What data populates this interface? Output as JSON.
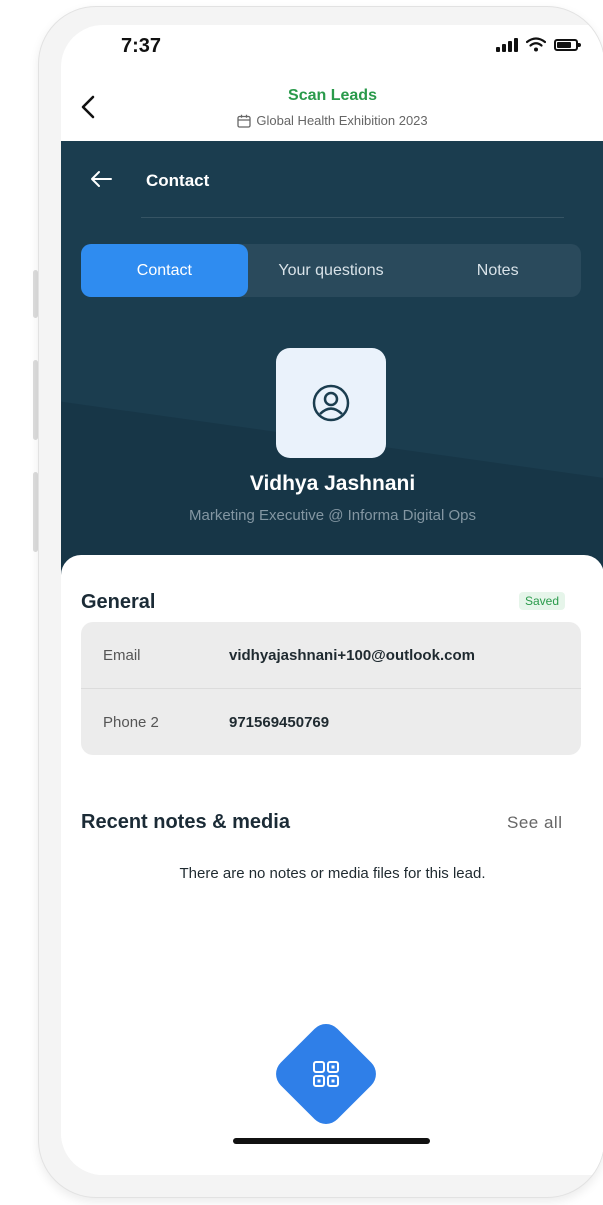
{
  "status": {
    "time": "7:37"
  },
  "nav": {
    "title": "Scan Leads",
    "subtitle": "Global Health Exhibition 2023"
  },
  "header": {
    "title": "Contact"
  },
  "tabs": [
    {
      "label": "Contact"
    },
    {
      "label": "Your questions"
    },
    {
      "label": "Notes"
    }
  ],
  "profile": {
    "name": "Vidhya Jashnani",
    "role": "Marketing Executive @ Informa Digital Ops"
  },
  "general": {
    "title": "General",
    "badge": "Saved",
    "rows": [
      {
        "label": "Email",
        "value": "vidhyajashnani+100@outlook.com"
      },
      {
        "label": "Phone 2",
        "value": "971569450769"
      }
    ]
  },
  "recent": {
    "title": "Recent notes & media",
    "see_all": "See all",
    "empty": "There are no notes or media files for this lead."
  },
  "colors": {
    "accent": "#2f8cf0",
    "header_bg": "#1b3d4f",
    "success": "#2a9a4b"
  },
  "icons": [
    "back-chevron-icon",
    "calendar-icon",
    "back-arrow-icon",
    "user-circle-icon",
    "qr-scan-icon",
    "signal-icon",
    "wifi-icon",
    "battery-icon"
  ]
}
